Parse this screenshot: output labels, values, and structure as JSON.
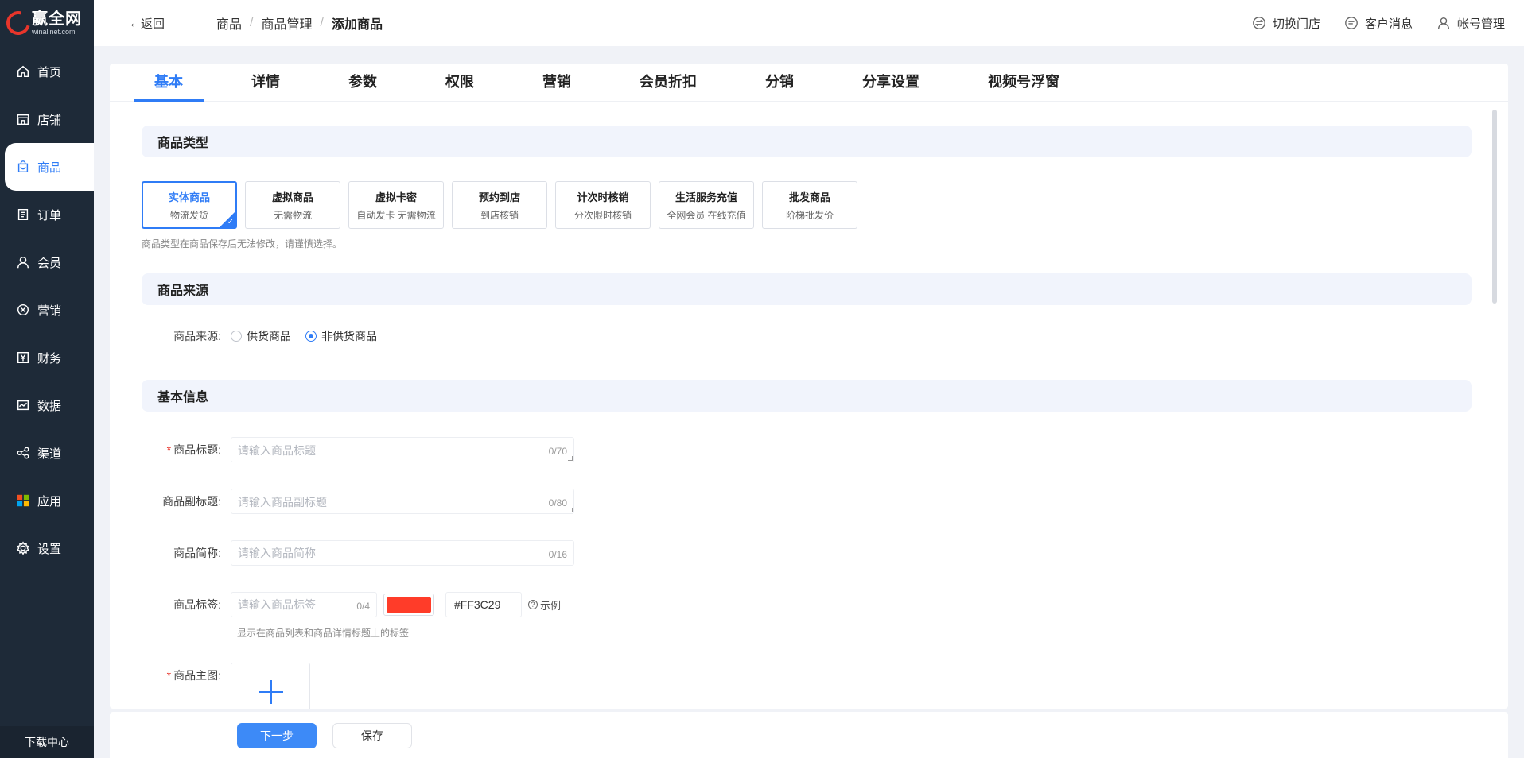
{
  "logo": {
    "name": "赢全网",
    "domain": "winallnet.com"
  },
  "sidebar": {
    "items": [
      {
        "label": "首页",
        "icon": "home-icon"
      },
      {
        "label": "店铺",
        "icon": "store-icon"
      },
      {
        "label": "商品",
        "icon": "bag-icon"
      },
      {
        "label": "订单",
        "icon": "order-icon"
      },
      {
        "label": "会员",
        "icon": "user-icon"
      },
      {
        "label": "营销",
        "icon": "marketing-icon"
      },
      {
        "label": "财务",
        "icon": "yen-icon"
      },
      {
        "label": "数据",
        "icon": "chart-icon"
      },
      {
        "label": "渠道",
        "icon": "share-icon"
      },
      {
        "label": "应用",
        "icon": "apps-icon"
      },
      {
        "label": "设置",
        "icon": "gear-icon"
      }
    ],
    "active": "商品",
    "download": "下载中心"
  },
  "header": {
    "back": "返回",
    "breadcrumb": [
      "商品",
      "商品管理",
      "添加商品"
    ],
    "switch_store": "切换门店",
    "messages": "客户消息",
    "account": "帐号管理"
  },
  "tabs": [
    "基本",
    "详情",
    "参数",
    "权限",
    "营销",
    "会员折扣",
    "分销",
    "分享设置",
    "视频号浮窗"
  ],
  "active_tab": "基本",
  "sections": {
    "type": "商品类型",
    "source": "商品来源",
    "basic": "基本信息"
  },
  "product_types": [
    {
      "title": "实体商品",
      "desc": "物流发货",
      "selected": true
    },
    {
      "title": "虚拟商品",
      "desc": "无需物流",
      "selected": false
    },
    {
      "title": "虚拟卡密",
      "desc": "自动发卡 无需物流",
      "selected": false
    },
    {
      "title": "预约到店",
      "desc": "到店核销",
      "selected": false
    },
    {
      "title": "计次时核销",
      "desc": "分次限时核销",
      "selected": false
    },
    {
      "title": "生活服务充值",
      "desc": "全网会员 在线充值",
      "selected": false
    },
    {
      "title": "批发商品",
      "desc": "阶梯批发价",
      "selected": false
    }
  ],
  "type_hint": "商品类型在商品保存后无法修改，请谨慎选择。",
  "source": {
    "label": "商品来源:",
    "options": [
      "供货商品",
      "非供货商品"
    ],
    "selected": "非供货商品"
  },
  "fields": {
    "title": {
      "label": "商品标题:",
      "required_mark": "*",
      "placeholder": "请输入商品标题",
      "count": "0/70"
    },
    "subtitle": {
      "label": "商品副标题:",
      "placeholder": "请输入商品副标题",
      "count": "0/80"
    },
    "short_name": {
      "label": "商品简称:",
      "placeholder": "请输入商品简称",
      "count": "0/16"
    },
    "tag": {
      "label": "商品标签:",
      "placeholder": "请输入商品标签",
      "count": "0/4",
      "color": "#FF3C29",
      "example": "示例",
      "hint": "显示在商品列表和商品详情标题上的标签"
    },
    "main_image": {
      "label": "商品主图:",
      "required_mark": "*"
    }
  },
  "footer": {
    "next": "下一步",
    "save": "保存"
  },
  "colors": {
    "accent": "#2f7cf6",
    "sidebar": "#1e2a38",
    "tag_color": "#FF3C29"
  }
}
